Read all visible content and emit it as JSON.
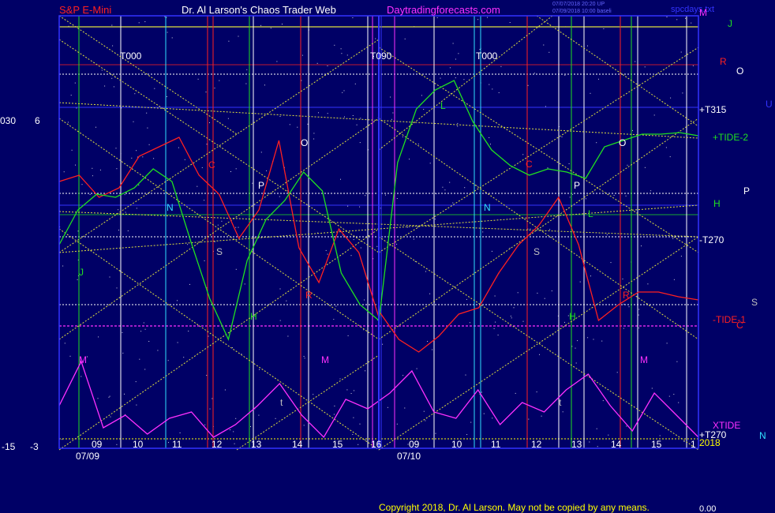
{
  "header": {
    "symbol": "S&P E-Mini",
    "site": "Dr. Al Larson's Chaos Trader Web",
    "url": "Daytradingforecasts.com",
    "stamp_top_right": "spcdays.txt",
    "stamp_line1": "07/07/2018 20:20 UP",
    "stamp_line2": "07/09/2018 10:00 baseli"
  },
  "footer": {
    "copyright": "Copyright 2018, Dr. Al Larson. May not be copied by any means.",
    "readout": "0.00"
  },
  "left_scale": {
    "top_left": "030",
    "top_right": "6",
    "bottom_left": "-15",
    "bottom_right": "-3"
  },
  "colors": {
    "background": "#000066",
    "frame": "#3333ff",
    "grid_yellow": "#e0e040",
    "price": "#ff2020",
    "tide2": "#20e020",
    "xtide": "#ff30ff",
    "cyan": "#30e0ff",
    "white": "#ffffff"
  },
  "chart_data": {
    "type": "line",
    "x": [
      "09",
      "10",
      "11",
      "12",
      "13",
      "14",
      "15",
      "16",
      "09",
      "10",
      "11",
      "12",
      "13",
      "14",
      "15",
      "1"
    ],
    "date_labels": [
      "07/09",
      "07/10"
    ],
    "top_labels": [
      "T000",
      "T090",
      "T000"
    ],
    "right_labels": [
      {
        "text": "M",
        "color": "#ff30ff"
      },
      {
        "text": "J",
        "color": "#20e020"
      },
      {
        "text": "R",
        "color": "#ff2020"
      },
      {
        "text": "O",
        "color": "#ffffff"
      },
      {
        "text": "U",
        "color": "#3333ff"
      },
      {
        "text": "+T315",
        "color": "#ffffff"
      },
      {
        "text": "+TIDE-2",
        "color": "#20e020"
      },
      {
        "text": "P",
        "color": "#ffffff"
      },
      {
        "text": "H",
        "color": "#20e020"
      },
      {
        "text": "-T270",
        "color": "#ffffff"
      },
      {
        "text": "S",
        "color": "#c0c0c0"
      },
      {
        "text": "-TIDE-1",
        "color": "#ff2020"
      },
      {
        "text": "C",
        "color": "#ff2020"
      },
      {
        "text": "XTIDE",
        "color": "#ff30ff"
      },
      {
        "text": "N",
        "color": "#30e0ff"
      },
      {
        "text": "+T270",
        "color": "#ffffff"
      },
      {
        "text": "2018",
        "color": "#ffff00"
      }
    ],
    "planet_markers": [
      "M",
      "C",
      "N",
      "P",
      "S",
      "O",
      "J",
      "H",
      "R",
      "t",
      "M",
      "C",
      "N",
      "P",
      "S",
      "O",
      "H",
      "R",
      "M",
      "t",
      "L",
      "L"
    ],
    "series": [
      {
        "name": "-TIDE-1",
        "values": [
          2.0,
          2.4,
          1.0,
          1.6,
          3.6,
          4.2,
          4.8,
          2.4,
          1.2,
          -1.6,
          0.2,
          4.6,
          -2.2,
          -4.4,
          -1.0,
          -2.5,
          -6.6,
          -6.2,
          -8.0,
          -8.8,
          -7.8,
          -6.4,
          -6.0,
          -3.8,
          -2.0,
          -0.8,
          1.0,
          -2.0,
          -6.8,
          -5.8,
          -5.0,
          -5.0,
          -5.3,
          -5.5
        ]
      },
      {
        "name": "+TIDE-2",
        "values": [
          -2.0,
          0.2,
          1.2,
          1.0,
          1.6,
          2.8,
          2.0,
          -1.8,
          -5.4,
          -8.0,
          -3.0,
          -0.4,
          0.8,
          2.6,
          1.4,
          -3.8,
          -5.8,
          -6.8,
          -6.9,
          3.2,
          6.6,
          7.8,
          8.4,
          5.8,
          4.0,
          3.0,
          2.4,
          2.8,
          2.6,
          2.2,
          4.2,
          4.6,
          5.0,
          5.0,
          5.1,
          4.9
        ]
      },
      {
        "name": "XTIDE",
        "values": [
          -12.2,
          -9.4,
          -13.6,
          -12.8,
          -14.0,
          -13.0,
          -12.6,
          -14.2,
          -13.4,
          -12.2,
          -10.8,
          -12.8,
          -14.2,
          -11.8,
          -12.4,
          -11.4,
          -10.0,
          -12.6,
          -13.0,
          -11.2,
          -13.4,
          -12.0,
          -12.6,
          -11.2,
          -10.2,
          -12.2,
          -13.8,
          -11.4,
          -12.8,
          -14.2
        ]
      }
    ]
  }
}
